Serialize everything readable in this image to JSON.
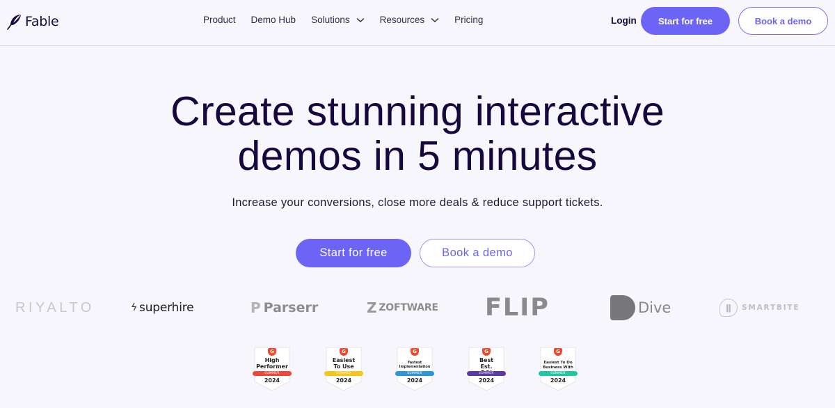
{
  "header": {
    "brand": "Fable",
    "nav": [
      {
        "label": "Product",
        "has_dropdown": false
      },
      {
        "label": "Demo Hub",
        "has_dropdown": false
      },
      {
        "label": "Solutions",
        "has_dropdown": true
      },
      {
        "label": "Resources",
        "has_dropdown": true
      },
      {
        "label": "Pricing",
        "has_dropdown": false
      }
    ],
    "login_label": "Login",
    "start_label": "Start for free",
    "demo_label": "Book a demo"
  },
  "hero": {
    "title_line1": "Create stunning interactive",
    "title_line2": "demos in 5 minutes",
    "subtitle": "Increase your conversions, close more deals & reduce support tickets.",
    "primary_cta": "Start for free",
    "secondary_cta": "Book a demo"
  },
  "customer_logos": [
    {
      "name": "RIYALTO"
    },
    {
      "name": "superhire"
    },
    {
      "name": "Parserr"
    },
    {
      "name": "ZOFTWARE"
    },
    {
      "name": "FLIP"
    },
    {
      "name": "Dive"
    },
    {
      "name": "SMARTBITE"
    }
  ],
  "badges": [
    {
      "brand": "G2",
      "title": "High Performer",
      "season": "SUMMER",
      "year": "2024",
      "color": "#f0473c"
    },
    {
      "brand": "G2",
      "title": "Easiest To Use",
      "season": "SUMMER",
      "year": "2024",
      "color": "#f5c518"
    },
    {
      "brand": "G2",
      "title": "Fastest Implementation",
      "season": "SUMMER",
      "year": "2024",
      "color": "#2f96d6"
    },
    {
      "brand": "G2",
      "title": "Best Est. ROI",
      "season": "SUMMER",
      "year": "2024",
      "color": "#5b3aa6"
    },
    {
      "brand": "G2",
      "title": "Easiest To Do Business With",
      "season": "SUMMER",
      "year": "2024",
      "color": "#1ec9a0"
    }
  ],
  "colors": {
    "accent": "#6c63f7",
    "heading": "#16073d",
    "background": "#f8f6fd"
  }
}
